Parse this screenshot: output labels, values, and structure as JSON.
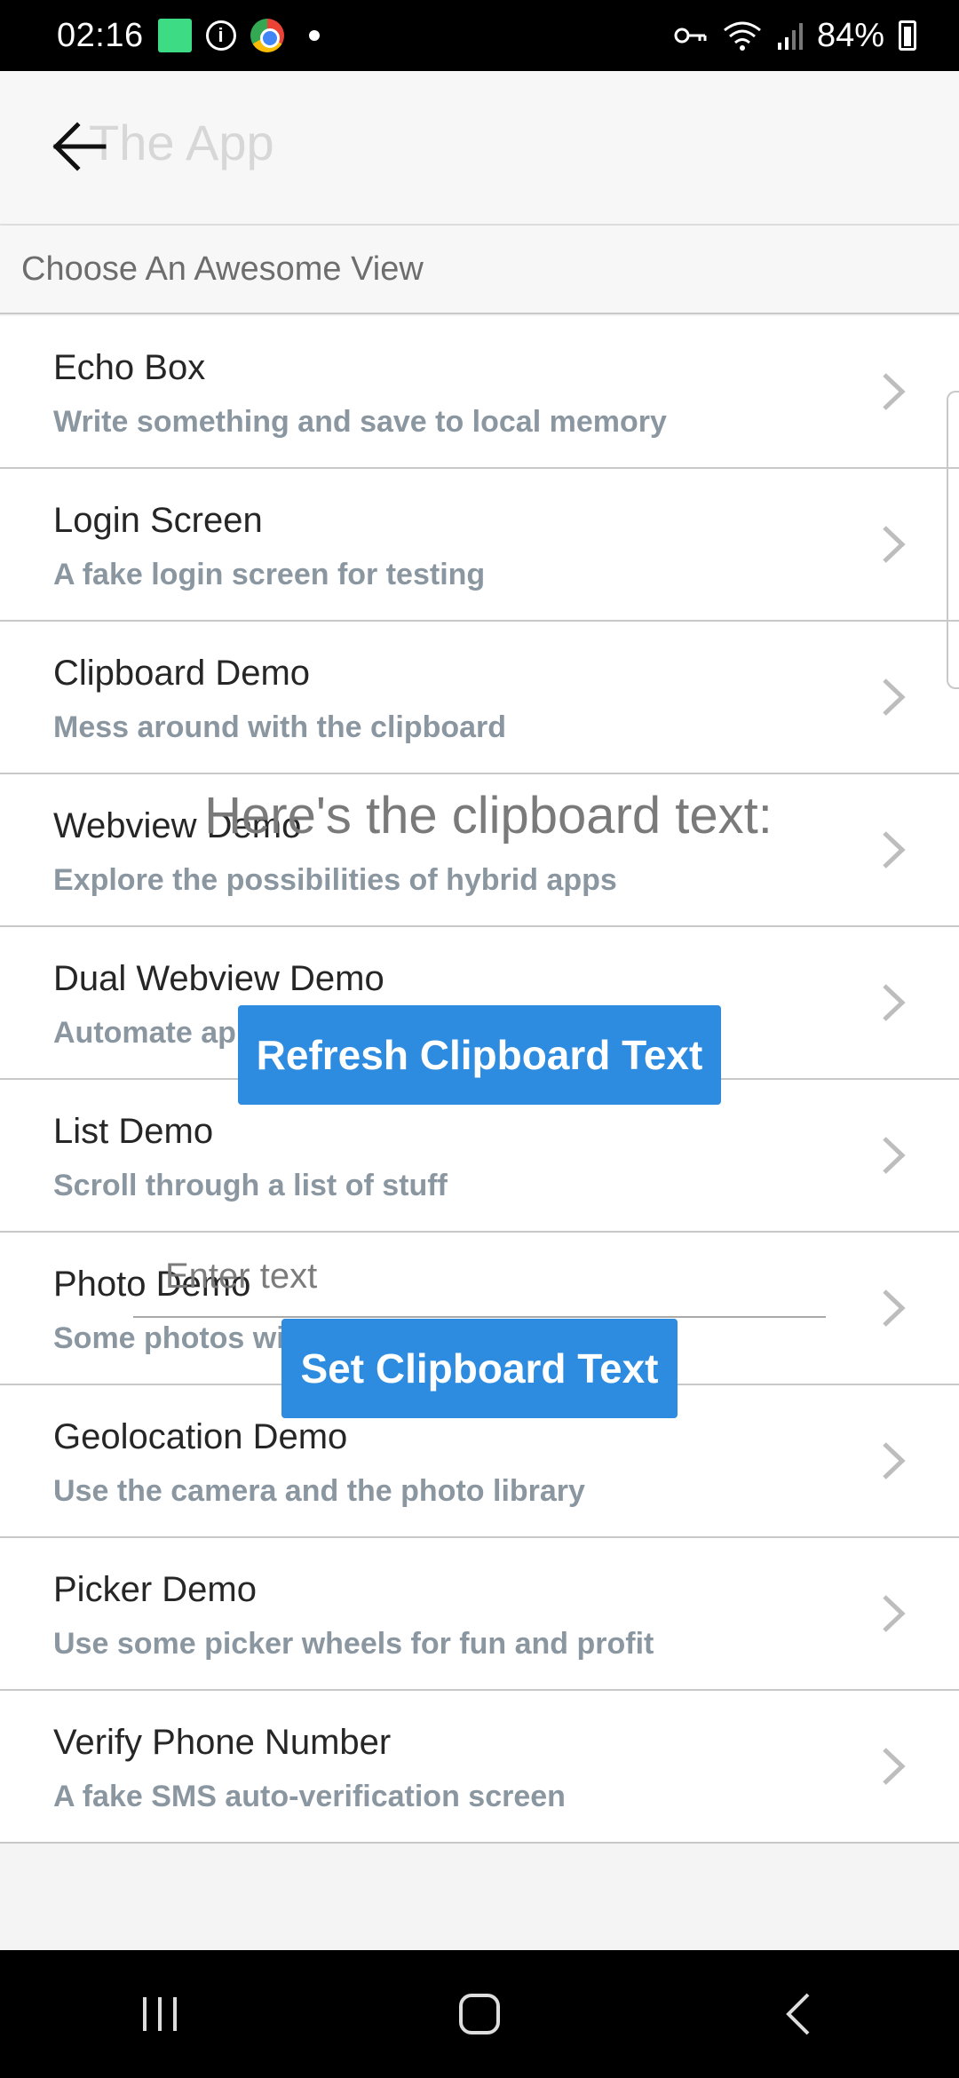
{
  "status": {
    "time": "02:16",
    "battery": "84%"
  },
  "app_bar": {
    "title": "The App"
  },
  "section": {
    "title": "Choose An Awesome View"
  },
  "items": [
    {
      "title": "Echo Box",
      "subtitle": "Write something and save to local memory"
    },
    {
      "title": "Login Screen",
      "subtitle": "A fake login screen for testing"
    },
    {
      "title": "Clipboard Demo",
      "subtitle": "Mess around with the clipboard"
    },
    {
      "title": "Webview Demo",
      "subtitle": "Explore the possibilities of hybrid apps"
    },
    {
      "title": "Dual Webview Demo",
      "subtitle": "Automate apps with multiple webviews"
    },
    {
      "title": "List Demo",
      "subtitle": "Scroll through a list of stuff"
    },
    {
      "title": "Photo Demo",
      "subtitle": "Some photos with an interesting layout"
    },
    {
      "title": "Geolocation Demo",
      "subtitle": "Use the camera and the photo library"
    },
    {
      "title": "Picker Demo",
      "subtitle": "Use some picker wheels for fun and profit"
    },
    {
      "title": "Verify Phone Number",
      "subtitle": "A fake SMS auto-verification screen"
    }
  ],
  "clipboard": {
    "heading": "Here's the clipboard text:",
    "refresh_label": "Refresh Clipboard Text",
    "input_placeholder": "Enter text",
    "input_value": "",
    "set_label": "Set Clipboard Text"
  },
  "colors": {
    "accent": "#2d8ce0",
    "subtitle": "#8a96a0"
  },
  "icons": {
    "back": "arrow-left-icon",
    "chevron": "chevron-right-icon",
    "nav_recent": "recent-apps-icon",
    "nav_home": "home-icon",
    "nav_back": "back-icon"
  }
}
